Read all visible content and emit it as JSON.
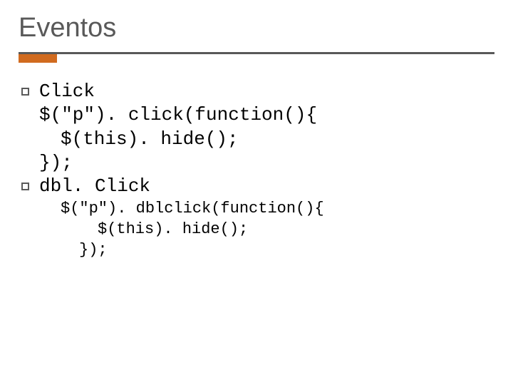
{
  "title": "Eventos",
  "items": [
    {
      "label": "Click",
      "code": [
        "$(\"p\"). click(function(){",
        "$(this). hide();",
        "});"
      ]
    },
    {
      "label": "dbl. Click",
      "code": [
        "$(\"p\"). dblclick(function(){",
        "$(this). hide();",
        "});"
      ]
    }
  ]
}
